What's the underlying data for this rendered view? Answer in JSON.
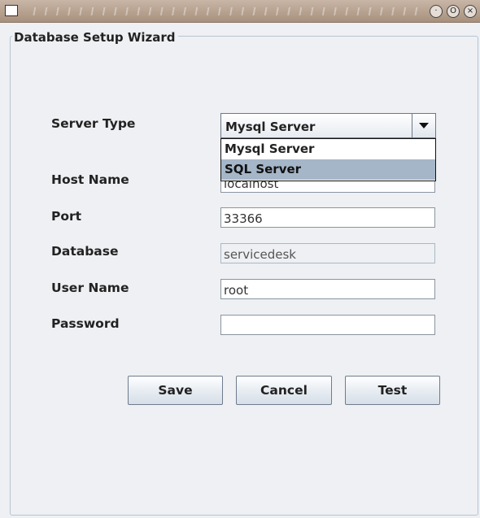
{
  "window": {
    "controls": {
      "minimize": "·",
      "maximize": "O",
      "close": "×"
    }
  },
  "group": {
    "title": "Database Setup Wizard"
  },
  "form": {
    "server_type": {
      "label": "Server Type",
      "value": "Mysql Server",
      "options": [
        "Mysql Server",
        "SQL Server"
      ],
      "highlighted": "SQL Server"
    },
    "host_name": {
      "label": "Host Name",
      "value": "localhost"
    },
    "port": {
      "label": "Port",
      "value": "33366"
    },
    "database": {
      "label": "Database",
      "value": "servicedesk"
    },
    "user_name": {
      "label": "User Name",
      "value": "root"
    },
    "password": {
      "label": "Password",
      "value": ""
    }
  },
  "buttons": {
    "save": "Save",
    "cancel": "Cancel",
    "test": "Test"
  }
}
